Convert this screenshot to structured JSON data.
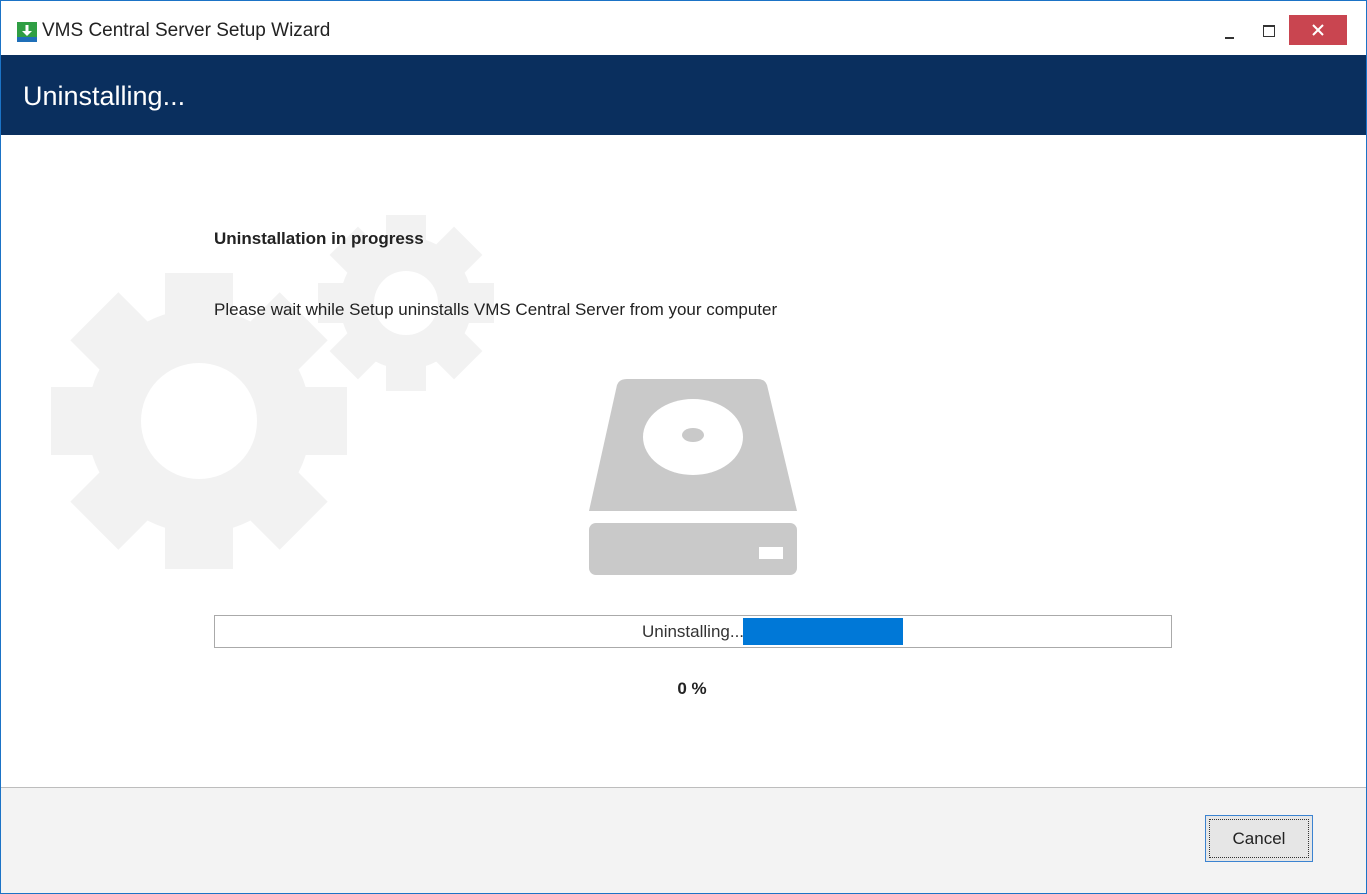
{
  "window": {
    "title": "VMS Central Server Setup Wizard",
    "icon": "download-installer-icon",
    "controls": [
      "minimize-icon",
      "maximize-icon",
      "close-icon"
    ]
  },
  "header": {
    "title": "Uninstalling..."
  },
  "main": {
    "heading": "Uninstallation in progress",
    "description": "Please wait while Setup uninstalls VMS Central Server from your computer",
    "illustration": "hard-drive-icon",
    "background_decoration": "gears-icon",
    "progress": {
      "label": "Uninstalling...",
      "percent_text": "0 %",
      "mode": "marquee"
    }
  },
  "footer": {
    "cancel_label": "Cancel"
  },
  "colors": {
    "header_bg": "#0a2f5e",
    "accent": "#0078d7",
    "close_button": "#c94550",
    "footer_bg": "#f3f3f3"
  }
}
